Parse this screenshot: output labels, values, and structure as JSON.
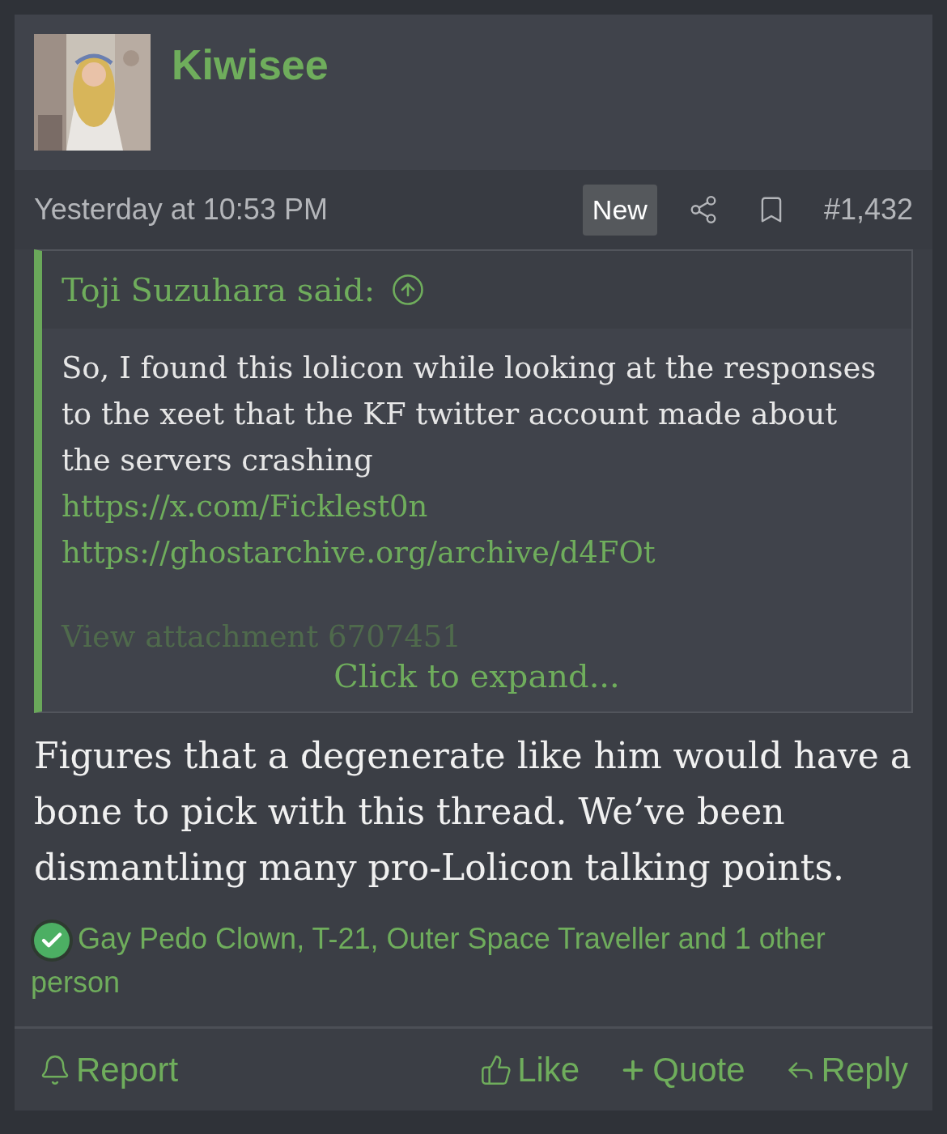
{
  "author": {
    "name": "Kiwisee"
  },
  "meta": {
    "time": "Yesterday at 10:53 PM",
    "badge": "New",
    "post_number": "#1,432"
  },
  "quote": {
    "attribution": "Toji Suzuhara said:",
    "text": "So, I found this lolicon while looking at the responses to the xeet that the KF twitter account made about the servers crashing",
    "links": [
      "https://x.com/Ficklest0n",
      "https://ghostarchive.org/archive/d4FOt"
    ],
    "faded": "View attachment 6707451",
    "expand": "Click to expand..."
  },
  "body": "Figures that a degenerate like him would have a bone to pick with this thread. We’ve been dismantling many pro-Lolicon talking points.",
  "reactions": {
    "text": "Gay Pedo Clown, T-21, Outer Space Traveller and 1 other person"
  },
  "actions": [
    {
      "kind": "report",
      "label": "Report"
    },
    {
      "kind": "like",
      "label": "Like"
    },
    {
      "kind": "quote",
      "label": "Quote"
    },
    {
      "kind": "reply",
      "label": "Reply"
    }
  ]
}
